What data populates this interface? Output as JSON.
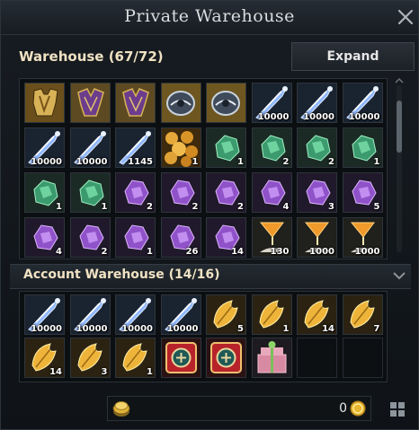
{
  "window": {
    "title": "Private Warehouse"
  },
  "warehouse": {
    "title": "Warehouse (67/72)",
    "expand_label": "Expand",
    "items": [
      {
        "icon": "armor-chest",
        "qty": ""
      },
      {
        "icon": "armor-chest-dark",
        "qty": ""
      },
      {
        "icon": "armor-chest-dark",
        "qty": ""
      },
      {
        "icon": "helmet",
        "qty": ""
      },
      {
        "icon": "helmet",
        "qty": ""
      },
      {
        "icon": "blue-crystal-shard",
        "qty": "10000"
      },
      {
        "icon": "blue-crystal-shard",
        "qty": "10000"
      },
      {
        "icon": "blue-crystal-shard",
        "qty": "10000"
      },
      {
        "icon": "blue-crystal-shard",
        "qty": "10000"
      },
      {
        "icon": "blue-crystal-shard",
        "qty": "10000"
      },
      {
        "icon": "blue-crystal-shard",
        "qty": "1145"
      },
      {
        "icon": "gold-nuggets",
        "qty": "1"
      },
      {
        "icon": "green-crystal",
        "qty": "1"
      },
      {
        "icon": "green-crystal",
        "qty": "2"
      },
      {
        "icon": "green-crystal",
        "qty": "2"
      },
      {
        "icon": "green-crystal",
        "qty": "1"
      },
      {
        "icon": "green-crystal",
        "qty": "1"
      },
      {
        "icon": "green-crystal",
        "qty": "1"
      },
      {
        "icon": "purple-crystal",
        "qty": "2"
      },
      {
        "icon": "purple-crystal",
        "qty": "2"
      },
      {
        "icon": "purple-crystal",
        "qty": "2"
      },
      {
        "icon": "purple-crystal",
        "qty": "4"
      },
      {
        "icon": "purple-crystal",
        "qty": "3"
      },
      {
        "icon": "purple-crystal",
        "qty": "5"
      },
      {
        "icon": "purple-crystal",
        "qty": "4"
      },
      {
        "icon": "purple-crystal",
        "qty": "2"
      },
      {
        "icon": "purple-crystal",
        "qty": "1"
      },
      {
        "icon": "purple-crystal",
        "qty": "26"
      },
      {
        "icon": "purple-crystal",
        "qty": "14"
      },
      {
        "icon": "orange-hourglass",
        "qty": "130"
      },
      {
        "icon": "orange-hourglass",
        "qty": "1000"
      },
      {
        "icon": "orange-hourglass",
        "qty": "1000"
      }
    ]
  },
  "account_warehouse": {
    "title": "Account Warehouse (14/16)",
    "items": [
      {
        "icon": "blue-crystal-shard",
        "qty": "10000"
      },
      {
        "icon": "blue-crystal-shard",
        "qty": "10000"
      },
      {
        "icon": "blue-crystal-shard",
        "qty": "10000"
      },
      {
        "icon": "blue-crystal-shard",
        "qty": "10000"
      },
      {
        "icon": "gold-leaf",
        "qty": "5"
      },
      {
        "icon": "gold-leaf",
        "qty": "1"
      },
      {
        "icon": "gold-leaf",
        "qty": "14"
      },
      {
        "icon": "gold-leaf",
        "qty": "7"
      },
      {
        "icon": "gold-leaf",
        "qty": "14"
      },
      {
        "icon": "gold-leaf",
        "qty": "3"
      },
      {
        "icon": "gold-leaf",
        "qty": "1"
      },
      {
        "icon": "red-emblem-box",
        "qty": ""
      },
      {
        "icon": "red-emblem-box",
        "qty": ""
      },
      {
        "icon": "gift-box",
        "qty": ""
      },
      {
        "icon": "",
        "qty": ""
      },
      {
        "icon": "",
        "qty": ""
      }
    ]
  },
  "footer": {
    "amount": "0",
    "coin_icon": "gold-coin-icon",
    "menu_icon": "grid-menu-icon"
  },
  "colors": {
    "header_text": "#f0e2c3",
    "frame": "#2e353c",
    "background": "#0f1317"
  }
}
